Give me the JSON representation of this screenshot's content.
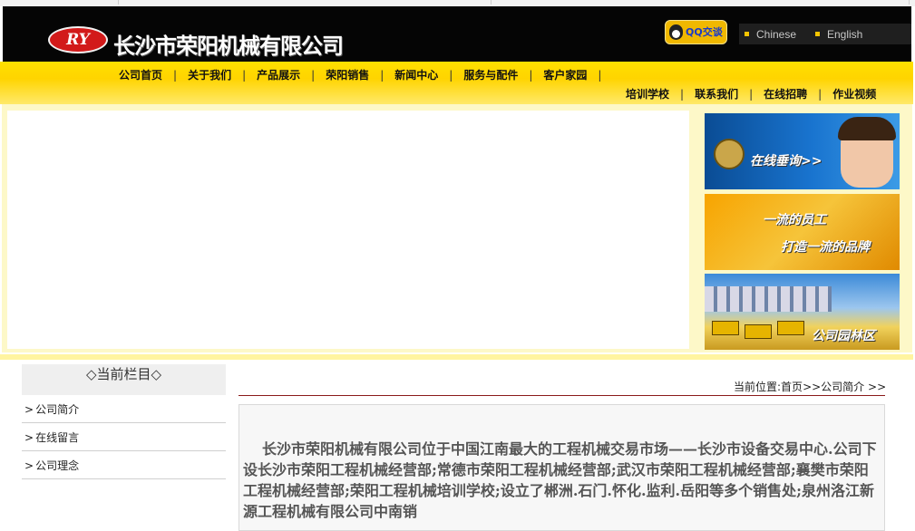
{
  "header": {
    "logo_mark": "RY",
    "company_name": "长沙市荣阳机械有限公司",
    "qq_button": "QQ交谈",
    "languages": [
      "Chinese",
      "English"
    ]
  },
  "nav": {
    "row1": [
      "公司首页",
      "关于我们",
      "产品展示",
      "荣阳销售",
      "新闻中心",
      "服务与配件",
      "客户家园"
    ],
    "row2": [
      "培训学校",
      "联系我们",
      "在线招聘",
      "作业视频"
    ],
    "separator": "|"
  },
  "banners": [
    {
      "text": "在线垂询>>",
      "icon": "telephone-icon"
    },
    {
      "text1": "一流的员工",
      "text2": "打造一流的品牌"
    },
    {
      "text": "公司园林区"
    }
  ],
  "sidebar": {
    "title": "◇当前栏目◇",
    "arrow": ">",
    "items": [
      "公司简介",
      "在线留言",
      "公司理念"
    ]
  },
  "breadcrumb": {
    "label": "当前位置:",
    "home": "首页",
    "sep": ">>",
    "current": "公司简介",
    "tail": ">>"
  },
  "content": {
    "paragraph": "长沙市荣阳机械有限公司位于中国江南最大的工程机械交易市场——长沙市设备交易中心.公司下设长沙市荣阳工程机械经营部;常德市荣阳工程机械经营部;武汉市荣阳工程机械经营部;襄樊市荣阳工程机械经营部;荣阳工程机械培训学校;设立了郴洲.石门.怀化.监利.岳阳等多个销售处;泉州洛江新源工程机械有限公司中南销"
  },
  "colors": {
    "header_bg": "#050505",
    "nav_yellow": "#ffd400",
    "logo_red": "#d21a1a",
    "accent_dark_red": "#8a1a1a"
  }
}
